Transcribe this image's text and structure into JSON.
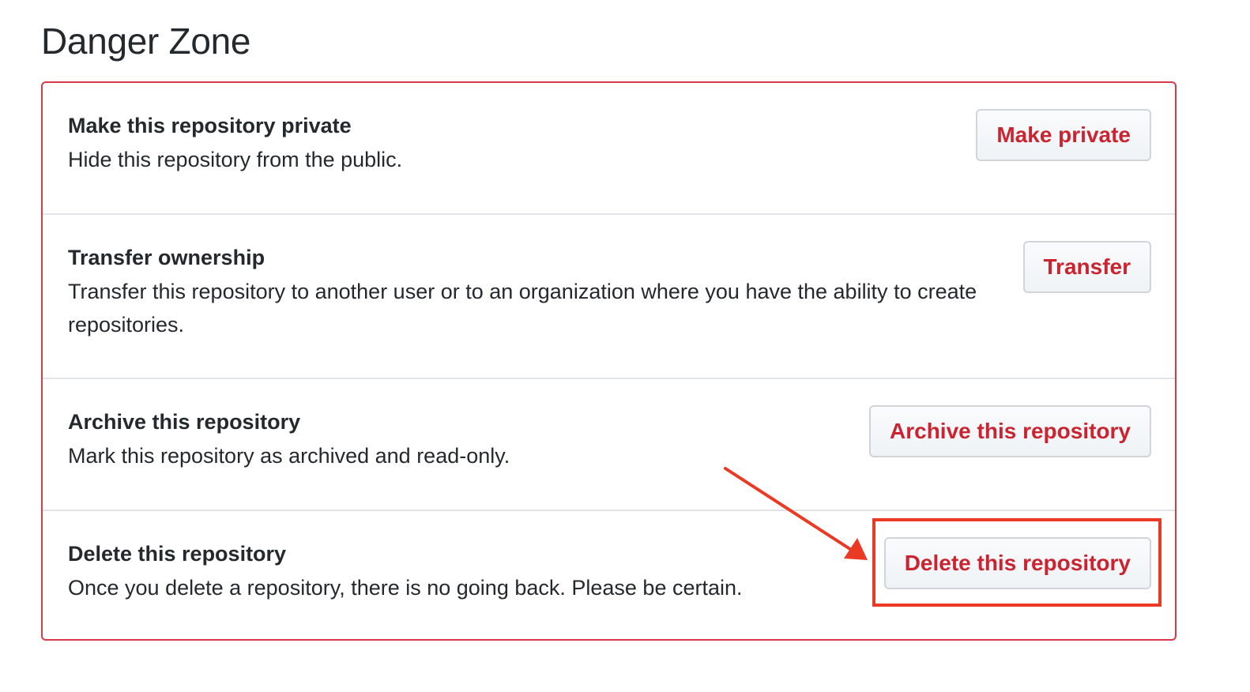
{
  "page": {
    "title": "Danger Zone"
  },
  "danger_zone": {
    "border_color": "#d73a49",
    "button_text_color": "#cb2431",
    "annotation_color": "#ea3a24",
    "rows": [
      {
        "title": "Make this repository private",
        "description": "Hide this repository from the public.",
        "button_label": "Make private"
      },
      {
        "title": "Transfer ownership",
        "description": "Transfer this repository to another user or to an organization where you have the ability to create repositories.",
        "button_label": "Transfer"
      },
      {
        "title": "Archive this repository",
        "description": "Mark this repository as archived and read-only.",
        "button_label": "Archive this repository"
      },
      {
        "title": "Delete this repository",
        "description": "Once you delete a repository, there is no going back. Please be certain.",
        "button_label": "Delete this repository"
      }
    ]
  }
}
